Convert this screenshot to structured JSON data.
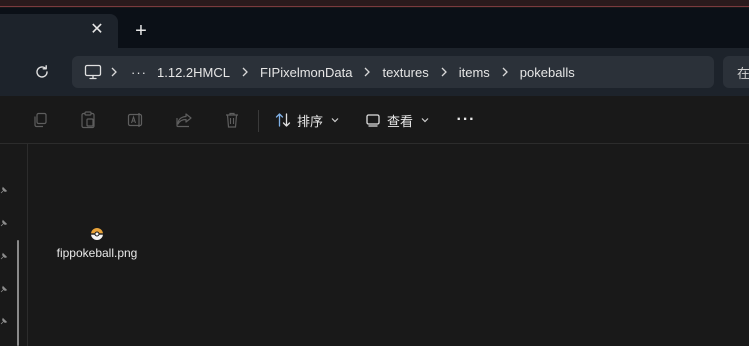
{
  "tabs": {
    "close_label": "✕",
    "new_tab_label": "+"
  },
  "address": {
    "overflow_label": "···",
    "crumbs": [
      "1.12.2HMCL",
      "FIPixelmonData",
      "textures",
      "items",
      "pokeballs"
    ],
    "search_placeholder": "在"
  },
  "toolbar": {
    "sort_label": "排序",
    "view_label": "查看",
    "more_label": "···"
  },
  "files": [
    {
      "name": "fippokeball.png",
      "icon": "pokeball-image-icon"
    }
  ],
  "icons": {
    "refresh": "refresh-icon",
    "this_pc": "monitor-icon",
    "copy": "copy-icon",
    "paste": "paste-icon",
    "rename": "rename-icon",
    "share": "share-icon",
    "delete": "trash-icon",
    "sort": "sort-icon",
    "view": "view-icon",
    "pin": "pin-icon"
  },
  "colors": {
    "tabstrip_bg": "#0b1017",
    "address_bg": "#1d232b",
    "breadcrumb_bg": "#2b3139",
    "content_bg": "#191919",
    "accent_line": "#7a3a3e"
  }
}
